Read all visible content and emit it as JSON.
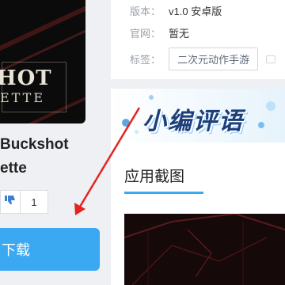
{
  "game": {
    "cover": {
      "title_line1": "HOT",
      "title_line2": "ETTE",
      "alt": "Buckshot Roulette cover art"
    },
    "name_line1": "Buckshot",
    "name_line2": "ette",
    "vote_count": "1",
    "download_label": "下载"
  },
  "info": {
    "version_label": "版本：",
    "version_value": "v1.0 安卓版",
    "site_label": "官网：",
    "site_value": "暂无",
    "tags_label": "标签：",
    "tags": [
      "二次元动作手游",
      ""
    ]
  },
  "review": {
    "banner_title": "小编评语",
    "screenshots_title": "应用截图"
  },
  "colors": {
    "accent": "#3ba8f2",
    "arrow": "#e52420",
    "banner_text": "#1d3f7a"
  },
  "icons": {
    "vote_down": "thumbs-down-icon",
    "annotation": "red-arrow"
  }
}
